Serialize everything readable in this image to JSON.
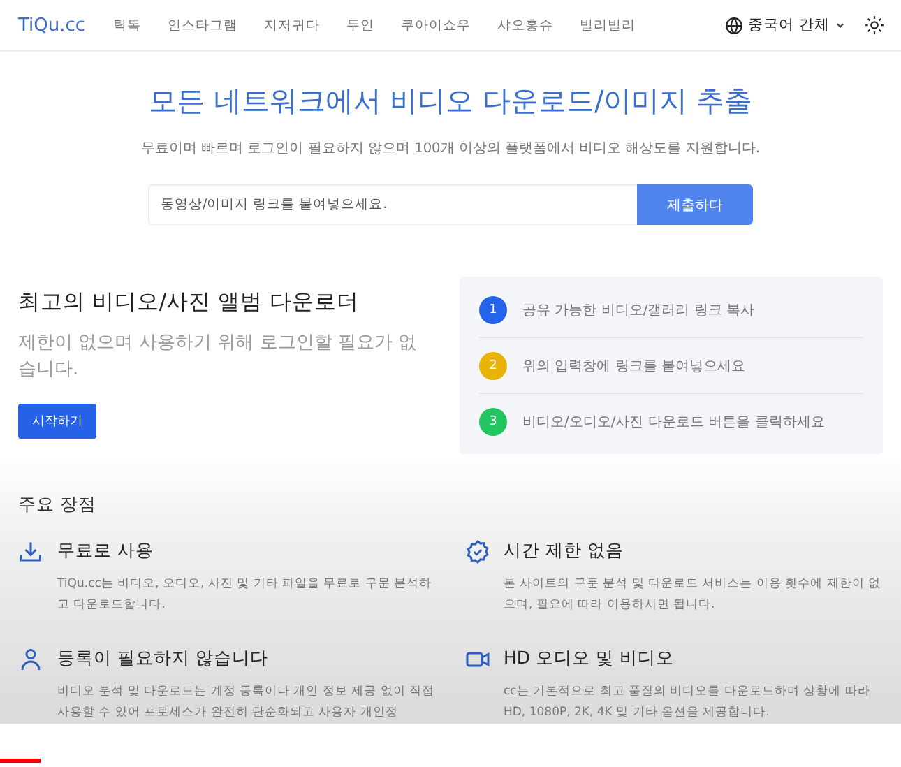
{
  "header": {
    "logo": "TiQu.cc",
    "nav": [
      "틱톡",
      "인스타그램",
      "지저귀다",
      "두인",
      "쿠아이쇼우",
      "샤오홍슈",
      "빌리빌리"
    ],
    "language": "중국어 간체"
  },
  "hero": {
    "title": "모든 네트워크에서 비디오 다운로드/이미지 추출",
    "subtitle": "무료이며 빠르며 로그인이 필요하지 않으며 100개 이상의 플랫폼에서 비디오 해상도를 지원합니다.",
    "placeholder": "동영상/이미지 링크를 붙여넣으세요.",
    "submit": "제출하다"
  },
  "intro": {
    "title": "최고의 비디오/사진 앨범 다운로더",
    "text": "제한이 없으며 사용하기 위해 로그인할 필요가 없습니다.",
    "button": "시작하기"
  },
  "steps": [
    {
      "number": "1",
      "text": "공유 가능한 비디오/갤러리 링크 복사",
      "color": "#2563eb"
    },
    {
      "number": "2",
      "text": "위의 입력창에 링크를 붙여넣으세요",
      "color": "#eab308"
    },
    {
      "number": "3",
      "text": "비디오/오디오/사진 다운로드 버튼을 클릭하세요",
      "color": "#22c55e"
    }
  ],
  "features": {
    "heading": "주요 장점",
    "items": [
      {
        "kind": "download",
        "title": "무료로 사용",
        "text": "TiQu.cc는 비디오, 오디오, 사진 및 기타 파일을 무료로 구문 분석하고 다운로드합니다."
      },
      {
        "kind": "badge",
        "title": "시간 제한 없음",
        "text": "본 사이트의 구문 분석 및 다운로드 서비스는 이용 횟수에 제한이 없으며, 필요에 따라 이용하시면 됩니다."
      },
      {
        "kind": "user",
        "title": "등록이 필요하지 않습니다",
        "text": "비디오 분석 및 다운로드는 계정 등록이나 개인 정보 제공 없이 직접 사용할 수 있어 프로세스가 완전히 단순화되고 사용자 개인정"
      },
      {
        "kind": "video",
        "title": "HD 오디오 및 비디오",
        "text": "cc는 기본적으로 최고 품질의 비디오를 다운로드하며 상황에 따라 HD, 1080P, 2K, 4K 및 기타 옵션을 제공합니다."
      }
    ]
  },
  "player": {
    "level": 0.045
  }
}
